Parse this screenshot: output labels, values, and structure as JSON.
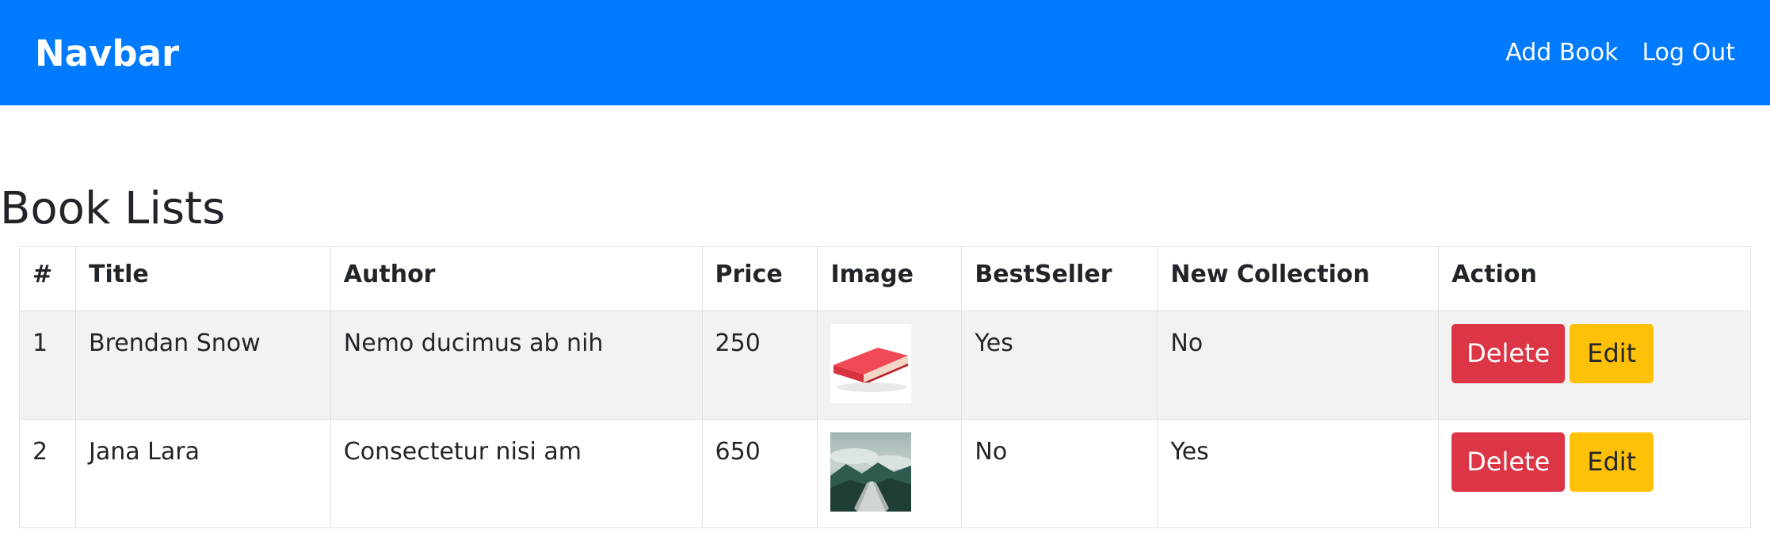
{
  "navbar": {
    "brand": "Navbar",
    "links": [
      "Add Book",
      "Log Out"
    ],
    "background": "#007bff"
  },
  "page": {
    "title": "Book Lists"
  },
  "table": {
    "headers": [
      "#",
      "Title",
      "Author",
      "Price",
      "Image",
      "BestSeller",
      "New Collection",
      "Action"
    ],
    "rows": [
      {
        "num": "1",
        "title": "Brendan Snow",
        "author": "Nemo ducimus ab nih",
        "price": "250",
        "image": "red-book-image",
        "bestseller": "Yes",
        "new_collection": "No",
        "delete_label": "Delete",
        "edit_label": "Edit"
      },
      {
        "num": "2",
        "title": "Jana Lara",
        "author": "Consectetur nisi am",
        "price": "650",
        "image": "open-book-landscape-image",
        "bestseller": "No",
        "new_collection": "Yes",
        "delete_label": "Delete",
        "edit_label": "Edit"
      }
    ]
  },
  "colors": {
    "danger": "#dc3545",
    "warning": "#ffc107",
    "stripe": "#f2f2f2"
  }
}
